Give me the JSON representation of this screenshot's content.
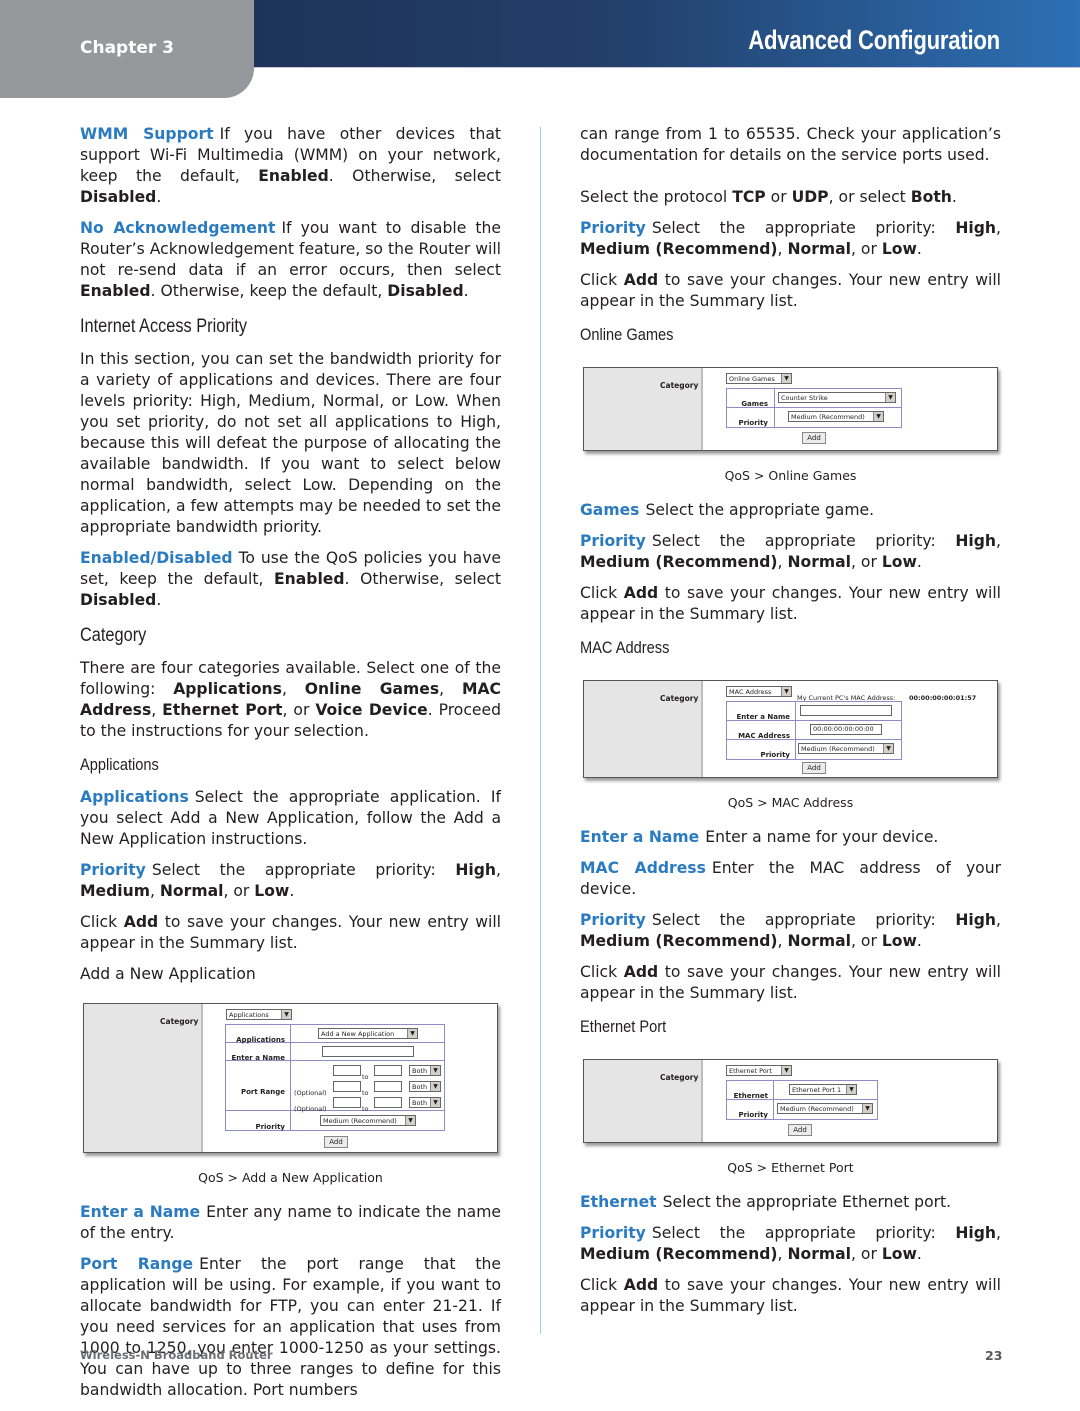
{
  "header": {
    "chapter": "Chapter 3",
    "section_title": "Advanced Configuration"
  },
  "colors": {
    "term_blue": "#2b7bc1",
    "header_dark": "#1e3358",
    "header_light": "#2d70b5",
    "chapter_tab_gray": "#97989b"
  },
  "left": {
    "wmm": {
      "term": "WMM Support",
      "t1": "If you have other devices that support Wi-Fi Multimedia (WMM) on your network, keep the default, ",
      "b1": "Enabled",
      "t2": ". Otherwise, select ",
      "b2": "Disabled",
      "t3": "."
    },
    "noack": {
      "term": "No Acknowledgement",
      "t1": "If you want to disable the Router’s Acknowledgement feature, so the Router will not re-send data if an error occurs, then select ",
      "b1": "Enabled",
      "t2": ". Otherwise, keep the default, ",
      "b2": "Disabled",
      "t3": "."
    },
    "iap_heading": "Internet Access Priority",
    "iap_body": "In this section, you can set the bandwidth priority for a variety of applications and devices. There are four levels priority: High, Medium, Normal, or Low. When you set priority, do not set all applications to High, because this will defeat the purpose of allocating the available bandwidth. If you want to select below normal bandwidth, select Low. Depending on the application, a few attempts may be needed to set the appropriate bandwidth priority.",
    "enabled": {
      "term": "Enabled/Disabled",
      "t1": "To use the QoS policies you have set, keep the default, ",
      "b1": "Enabled",
      "t2": ". Otherwise, select ",
      "b2": "Disabled",
      "t3": "."
    },
    "category_heading": "Category",
    "category_body": {
      "t1": "There are four categories available. Select one of the following: ",
      "b1": "Applications",
      "s1": ", ",
      "b2": "Online Games",
      "s2": ", ",
      "b3": "MAC Address",
      "s3": ", ",
      "b4": "Ethernet Port",
      "s4": ", or ",
      "b5": "Voice Device",
      "t2": ". Proceed to the instructions for your selection."
    },
    "applications_heading": "Applications",
    "applications": {
      "term": "Applications",
      "text": "Select the appropriate application. If you select Add a New Application, follow the Add a New Application instructions."
    },
    "priority": {
      "term": "Priority",
      "t1": "Select the appropriate priority: ",
      "b1": "High",
      "s1": ", ",
      "b2": "Medium",
      "s2": ", ",
      "b3": "Normal",
      "s3": ", or ",
      "b4": "Low",
      "t2": "."
    },
    "click_add": {
      "t1": "Click ",
      "b1": "Add",
      "t2": " to save your changes. Your new entry will appear in the Summary list."
    },
    "add_new_app_label": "Add a New Application",
    "screenshot": {
      "category_label": "Category",
      "category_value": "Applications",
      "applications_label": "Applications",
      "applications_value": "Add a New Application",
      "enter_name_label": "Enter a Name",
      "port_range_label": "Port Range",
      "optional_label": "(Optional)",
      "to_label": "to",
      "protocol_value": "Both",
      "priority_label": "Priority",
      "priority_value": "Medium (Recommend)",
      "add_button": "Add"
    },
    "caption": "QoS > Add a New Application",
    "enter_name": {
      "term": "Enter a Name",
      "text": "Enter any name to indicate the name of the entry."
    },
    "port_range": {
      "term": "Port Range",
      "text": "Enter the port range that the application will be using. For example, if you want to allocate bandwidth for FTP, you can enter 21-21. If you need services for an application that uses from 1000 to 1250, you enter 1000-1250 as your settings. You can have up to three ranges to define for this bandwidth allocation. Port numbers"
    }
  },
  "right": {
    "cont": "can range from 1 to 65535. Check your application’s documentation for details on the service ports used.",
    "protocol": {
      "t1": "Select the protocol ",
      "b1": "TCP",
      "t2": " or ",
      "b2": "UDP",
      "t3": ", or select ",
      "b3": "Both",
      "t4": "."
    },
    "priority": {
      "term": "Priority",
      "t1": "Select the appropriate priority: ",
      "b1": "High",
      "s1": ", ",
      "b2": "Medium (Recommend)",
      "s2": ", ",
      "b3": "Normal",
      "s3": ", or ",
      "b4": "Low",
      "t2": "."
    },
    "click_add": {
      "t1": "Click ",
      "b1": "Add",
      "t2": " to save your changes. Your new entry will appear in the Summary list."
    },
    "online_games_heading": "Online Games",
    "games_shot": {
      "category_label": "Category",
      "category_value": "Online Games",
      "games_label": "Games",
      "games_value": "Counter Strike",
      "priority_label": "Priority",
      "priority_value": "Medium (Recommend)",
      "add_button": "Add"
    },
    "games_caption": "QoS > Online Games",
    "games": {
      "term": "Games",
      "text": "Select the appropriate game."
    },
    "mac_heading": "MAC Address",
    "mac_shot": {
      "category_label": "Category",
      "category_value": "MAC Address",
      "current_mac_label": "My Current PC's MAC Address:",
      "current_mac_value": "00:00:00:00:01:57",
      "enter_name_label": "Enter a Name",
      "mac_label": "MAC Address",
      "mac_value": "00:00:00:00:00:00",
      "priority_label": "Priority",
      "priority_value": "Medium (Recommend)",
      "add_button": "Add"
    },
    "mac_caption": "QoS > MAC Address",
    "enter_name": {
      "term": "Enter a Name",
      "text": "Enter a name for your device."
    },
    "mac_address": {
      "term": "MAC Address",
      "text": "Enter the MAC address of your device."
    },
    "ethernet_heading": "Ethernet Port",
    "eth_shot": {
      "category_label": "Category",
      "category_value": "Ethernet Port",
      "ethernet_label": "Ethernet",
      "ethernet_value": "Ethernet Port 1",
      "priority_label": "Priority",
      "priority_value": "Medium (Recommend)",
      "add_button": "Add"
    },
    "eth_caption": "QoS > Ethernet Port",
    "ethernet": {
      "term": "Ethernet",
      "text": "Select the appropriate Ethernet port."
    }
  },
  "footer": {
    "product": "Wireless-N Broadband Router",
    "page_number": "23"
  }
}
